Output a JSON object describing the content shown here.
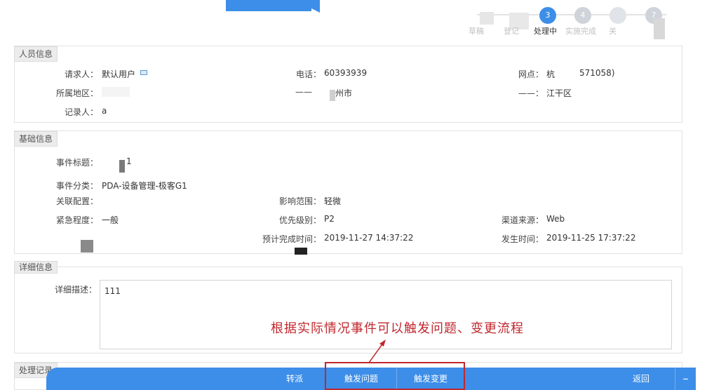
{
  "steps": [
    {
      "num": "",
      "label": "草稿",
      "active": false
    },
    {
      "num": "",
      "label": "登记",
      "active": false
    },
    {
      "num": "3",
      "label": "处理中",
      "active": true
    },
    {
      "num": "4",
      "label": "实施完成",
      "active": false
    },
    {
      "num": "",
      "label": "关",
      "active": false
    },
    {
      "num": "7",
      "label": "",
      "active": false
    }
  ],
  "person": {
    "section_title": "人员信息",
    "requester_label": "请求人：",
    "requester_value": "默认用户",
    "phone_label": "电话：",
    "phone_value": "60393939",
    "site_label": "网点：",
    "site_value": "杭",
    "site_code": "571058)",
    "region_label": "所属地区：",
    "city_label": "——",
    "city_value": "州市",
    "district_label": "——：",
    "district_value": "江干区",
    "recorder_label": "记录人：",
    "recorder_value": "a"
  },
  "basic": {
    "section_title": "基础信息",
    "title_label": "事件标题：",
    "title_value": "1",
    "category_label": "事件分类：",
    "category_value": "PDA-设备管理-极客G1",
    "config_label": "关联配置：",
    "impact_label": "影响范围：",
    "impact_value": "轻微",
    "urgency_label": "紧急程度：",
    "urgency_value": "一般",
    "priority_label": "优先级别：",
    "priority_value": "P2",
    "channel_label": "渠道来源：",
    "channel_value": "Web",
    "planned_label": "预计完成时间：",
    "planned_value": "2019-11-27 14:37:22",
    "occurred_label": "发生时间：",
    "occurred_value": "2019-11-25 17:37:22"
  },
  "detail": {
    "section_title": "详细信息",
    "desc_label": "详细描述：",
    "desc_value": "111"
  },
  "record": {
    "section_title": "处理记录"
  },
  "annotation": {
    "text": "根据实际情况事件可以触发问题、变更流程"
  },
  "bottom_bar": {
    "dispatch_label": "转派",
    "trigger_problem_label": "触发问题",
    "trigger_change_label": "触发变更",
    "back_label": "返回",
    "collapse_label": "–"
  },
  "colors": {
    "accent": "#3d8ee8",
    "annotation": "#c0272d"
  }
}
